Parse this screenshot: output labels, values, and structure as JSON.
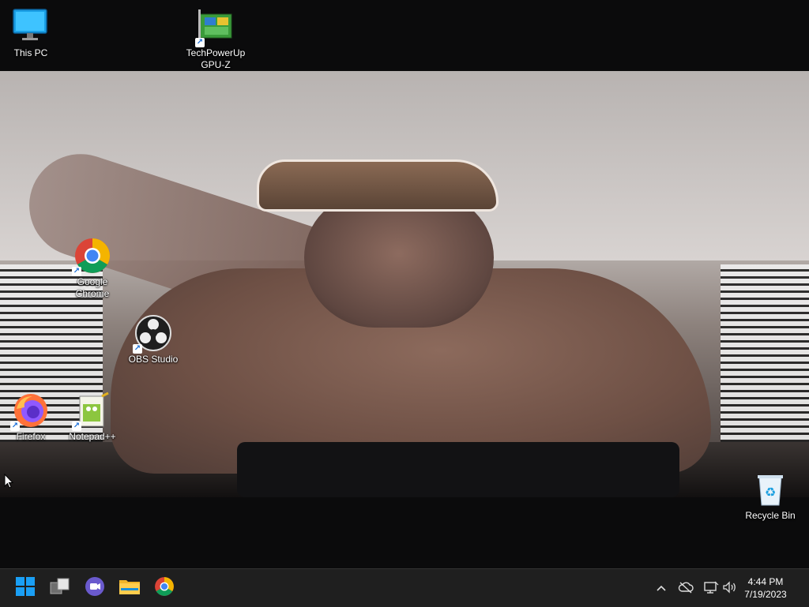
{
  "desktop": {
    "icons": [
      {
        "label": "This PC",
        "icon": "this-pc-icon"
      },
      {
        "label": "TechPowerUp\nGPU-Z",
        "icon": "gpu-z-icon"
      },
      {
        "label": "Google\nChrome",
        "icon": "chrome-icon"
      },
      {
        "label": "OBS Studio",
        "icon": "obs-icon"
      },
      {
        "label": "Firefox",
        "icon": "firefox-icon"
      },
      {
        "label": "Notepad++",
        "icon": "notepadpp-icon"
      },
      {
        "label": "Recycle Bin",
        "icon": "recycle-bin-icon"
      }
    ]
  },
  "taskbar": {
    "apps": [
      {
        "name": "Start",
        "icon": "windows-start-icon"
      },
      {
        "name": "Task View",
        "icon": "task-view-icon"
      },
      {
        "name": "Chat",
        "icon": "teams-chat-icon"
      },
      {
        "name": "File Explorer",
        "icon": "folder-icon"
      },
      {
        "name": "Google Chrome",
        "icon": "chrome-icon"
      }
    ],
    "tray": {
      "icons": [
        "chevron-up-icon",
        "cloud-off-icon",
        "network-icon",
        "volume-icon"
      ],
      "time": "4:44 PM",
      "date": "7/19/2023"
    }
  },
  "colors": {
    "taskbar": "#1f1f1f",
    "windows_blue": "#0a84ff",
    "chrome_red": "#db4437",
    "chrome_yellow": "#f4b400",
    "chrome_green": "#0f9d58",
    "chrome_blue": "#4285f4"
  }
}
